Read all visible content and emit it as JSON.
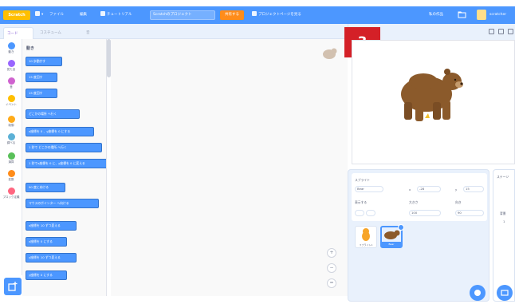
{
  "menubar": {
    "logo": "Scratch",
    "file": "ファイル",
    "edit": "編集",
    "tutorials": "チュートリアル",
    "project_title": "Scratchのプロジェクト",
    "share": "共有する",
    "see_project_page": "プロジェクトページを見る",
    "my_stuff": "私の作品",
    "username": "scratcher"
  },
  "tabs": {
    "code": "コード",
    "costumes": "コスチューム",
    "sounds": "音"
  },
  "categories": [
    {
      "label": "動き",
      "color": "#4c97ff"
    },
    {
      "label": "見た目",
      "color": "#9966ff"
    },
    {
      "label": "音",
      "color": "#cf63cf"
    },
    {
      "label": "イベント",
      "color": "#ffbf00"
    },
    {
      "label": "制御",
      "color": "#ffab19"
    },
    {
      "label": "調べる",
      "color": "#5cb1d6"
    },
    {
      "label": "演算",
      "color": "#59c059"
    },
    {
      "label": "変数",
      "color": "#ff8c1a"
    },
    {
      "label": "ブロック定義",
      "color": "#ff6680"
    }
  ],
  "palette": {
    "heading": "動き",
    "blocks": [
      "10 歩動かす",
      "15 度回す",
      "15 度回す",
      "どこかの場所 へ行く",
      "x座標を 0 、y座標を 0 にする",
      "1 秒で どこかの場所 へ行く",
      "1 秒でx座標を 0 に、y座標を 0 に変える",
      "90 度に向ける",
      "マウスのポインター へ向ける",
      "x座標を 10 ずつ変える",
      "x座標を 0 にする",
      "y座標を 10 ずつ変える",
      "y座標を 0 にする"
    ]
  },
  "badge": "3",
  "sprite_info": {
    "sprite_label": "スプライト",
    "sprite_name": "Bear",
    "x_label": "x",
    "x_value": "-28",
    "y_label": "y",
    "y_value": "15",
    "show_label": "表示する",
    "size_label": "大きさ",
    "size_value": "100",
    "direction_label": "向き",
    "direction_value": "90"
  },
  "sprites": [
    {
      "name": "スプライト1"
    },
    {
      "name": "Bear"
    }
  ],
  "stage_pane": {
    "label": "ステージ",
    "backdrops_label": "背景",
    "backdrops_count": "1"
  },
  "colors": {
    "accent": "#4c97ff",
    "badge": "#d42027",
    "bear": "#8b5a2b"
  }
}
